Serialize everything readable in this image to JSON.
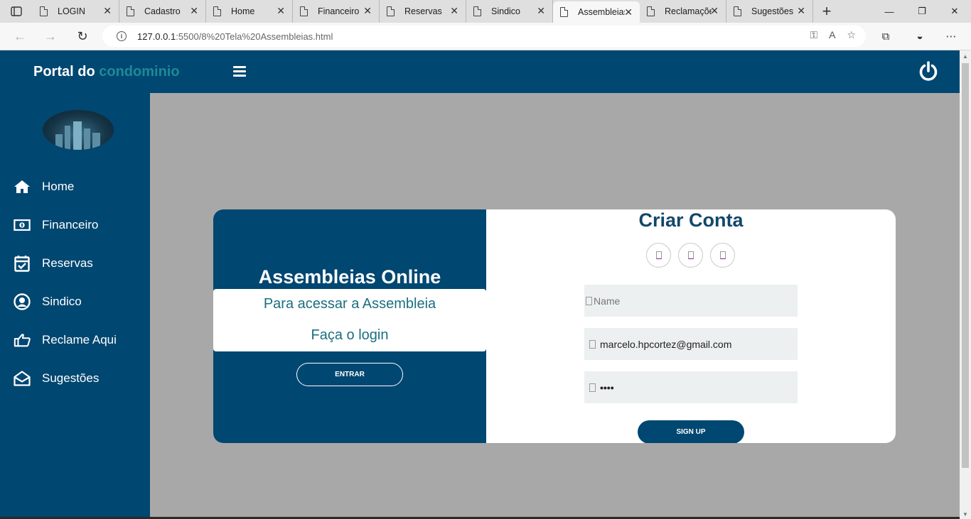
{
  "browser": {
    "tabs": [
      {
        "title": "LOGIN",
        "active": false
      },
      {
        "title": "Cadastro",
        "active": false
      },
      {
        "title": "Home",
        "active": false
      },
      {
        "title": "Financeiro",
        "active": false
      },
      {
        "title": "Reservas",
        "active": false
      },
      {
        "title": "Sindico",
        "active": false
      },
      {
        "title": "Assembleias",
        "active": true
      },
      {
        "title": "Reclamações",
        "active": false
      },
      {
        "title": "Sugestões",
        "active": false
      }
    ],
    "url_host": "127.0.0.1",
    "url_rest": ":5500/8%20Tela%20Assembleias.html"
  },
  "header": {
    "brand_prefix": "Portal do",
    "brand_accent": "condominio",
    "accent_color": "#1e8a96",
    "nav_color": "#004771"
  },
  "sidebar": {
    "items": [
      {
        "label": "Home",
        "icon": "home-icon"
      },
      {
        "label": "Financeiro",
        "icon": "money-icon"
      },
      {
        "label": "Reservas",
        "icon": "calendar-check-icon"
      },
      {
        "label": "Sindico",
        "icon": "user-circle-icon"
      },
      {
        "label": "Reclame Aqui",
        "icon": "hand-point-icon"
      },
      {
        "label": "Sugestões",
        "icon": "envelope-open-icon"
      }
    ]
  },
  "panel": {
    "title": "Assembleias Online",
    "line1": "Para acessar a Assembleia",
    "line2": "Faça o login",
    "entrar_label": "ENTRAR"
  },
  "signup": {
    "title": "Criar Conta",
    "name_placeholder": "Name",
    "email_value": "marcelo.hpcortez@gmail.com",
    "password_mask": "••••",
    "button_label": "SIGN UP"
  }
}
